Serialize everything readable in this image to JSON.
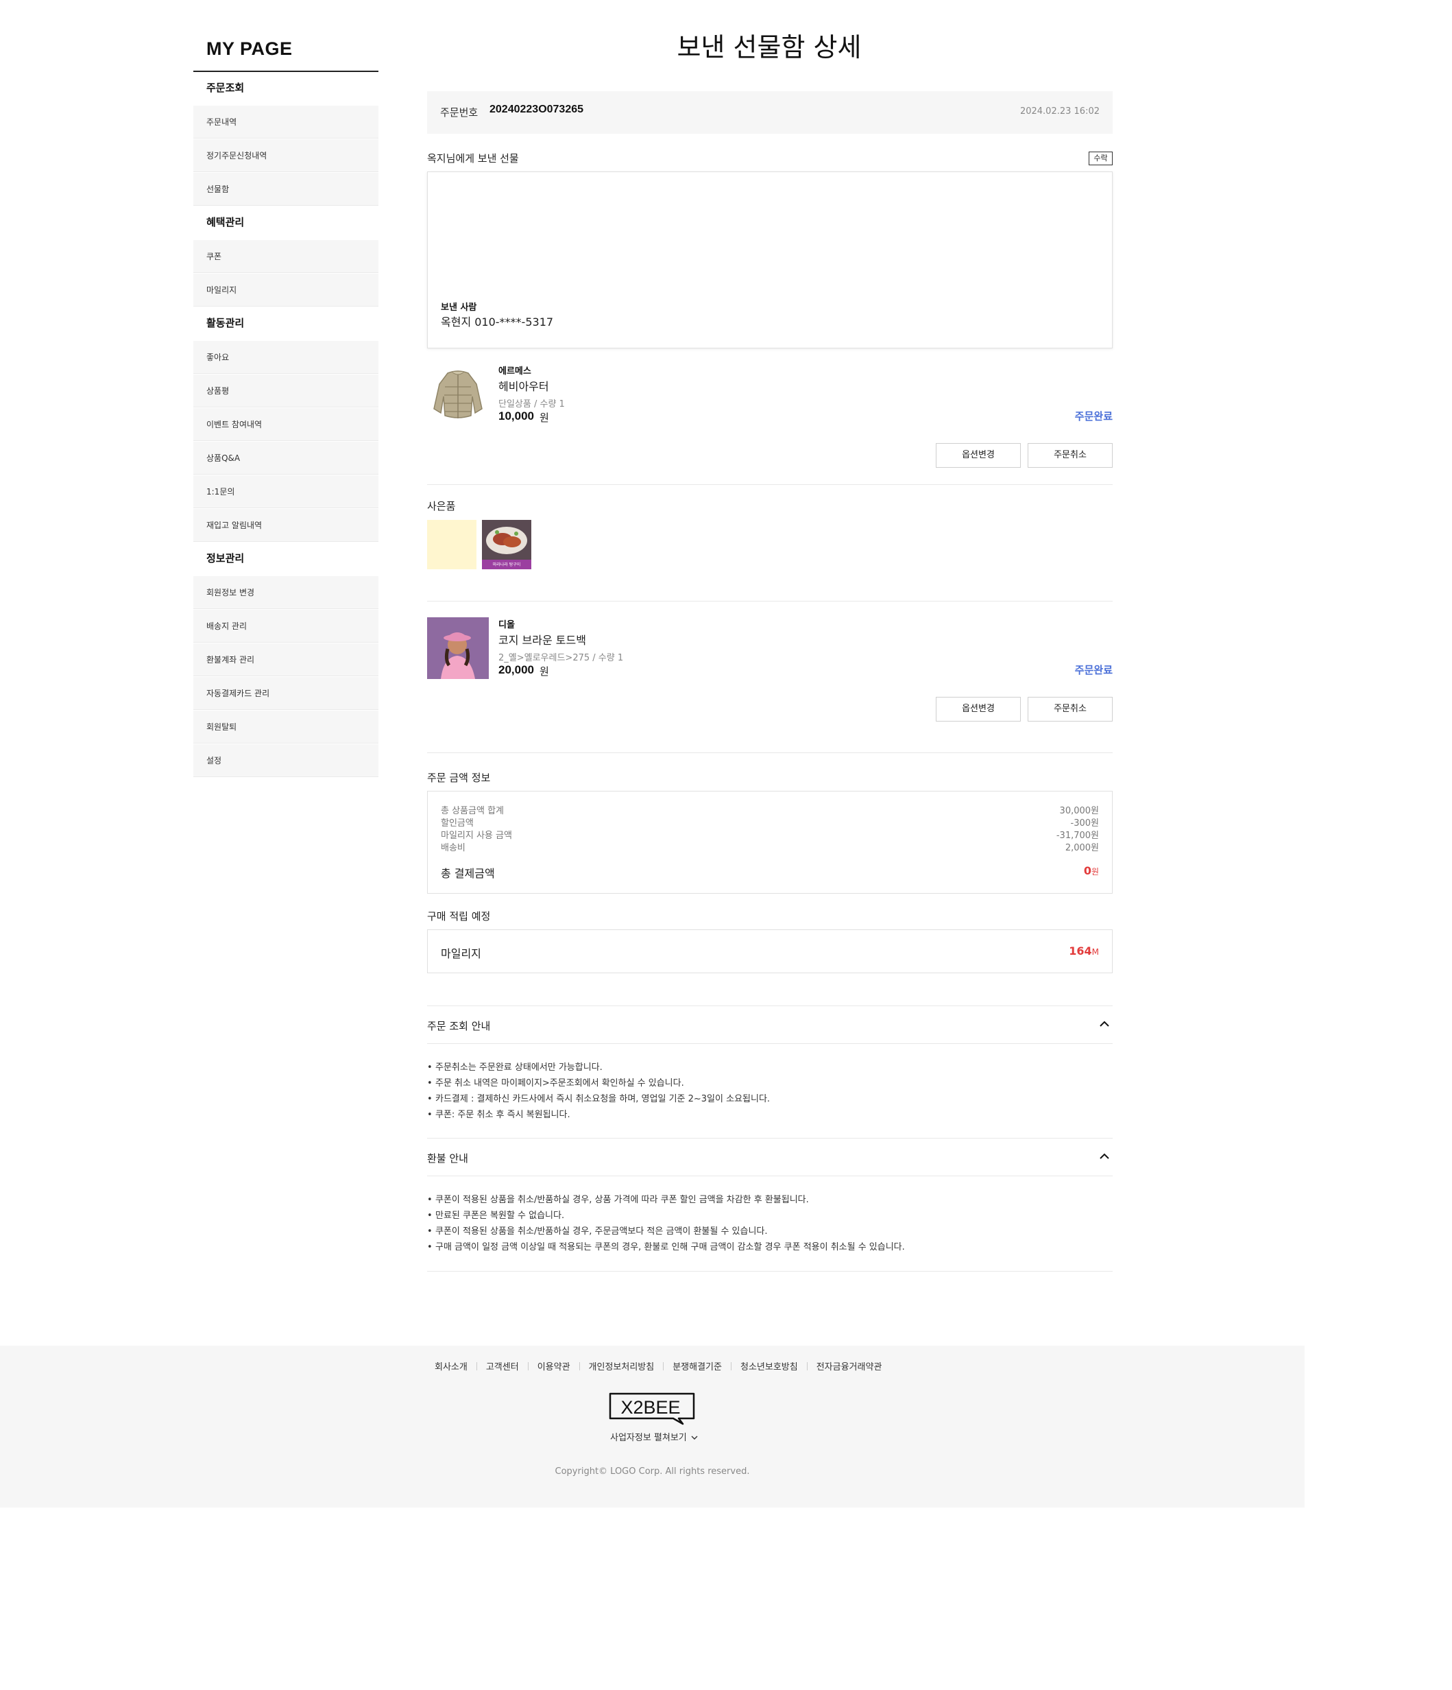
{
  "sidebar": {
    "title": "MY PAGE",
    "sections": [
      {
        "label": "주문조회",
        "items": [
          "주문내역",
          "정기주문신청내역",
          "선물함"
        ]
      },
      {
        "label": "혜택관리",
        "items": [
          "쿠폰",
          "마일리지"
        ]
      },
      {
        "label": "활동관리",
        "items": [
          "좋아요",
          "상품평",
          "이벤트 참여내역",
          "상품Q&A",
          "1:1문의",
          "재입고 알림내역"
        ]
      },
      {
        "label": "정보관리",
        "items": [
          "회원정보 변경",
          "배송지 관리",
          "환불계좌 관리",
          "자동결제카드 관리",
          "회원탈퇴",
          "설정"
        ]
      }
    ]
  },
  "page": {
    "title": "보낸 선물함 상세"
  },
  "order": {
    "label": "주문번호",
    "number": "20240223O073265",
    "date": "2024.02.23 16:02"
  },
  "gift": {
    "title": "옥지님에게 보낸 선물",
    "badge": "수락",
    "sender_label": "보낸 사람",
    "sender_value": "옥현지 010-****-5317"
  },
  "products": [
    {
      "brand": "에르메스",
      "name": "헤비아우터",
      "option": "단일상품 / 수량 1",
      "price": "10,000",
      "unit": "원",
      "status": "주문완료",
      "btn_option": "옵션변경",
      "btn_cancel": "주문취소",
      "thumb": "puffer-jacket-image"
    },
    {
      "brand": "디올",
      "name": "코지 브라운 토드백",
      "option": "2_옐>옐로우레드>275 / 수량 1",
      "price": "20,000",
      "unit": "원",
      "status": "주문완료",
      "btn_option": "옵션변경",
      "btn_cancel": "주문취소",
      "thumb": "woman-pink-hat-image"
    }
  ],
  "freebie": {
    "title": "사은품",
    "item2_caption": "마라나라 탕구이"
  },
  "amount": {
    "title": "주문 금액 정보",
    "rows": [
      {
        "label": "총 상품금액 합계",
        "value": "30,000원"
      },
      {
        "label": "할인금액",
        "value": "-300원"
      },
      {
        "label": "마일리지 사용 금액",
        "value": "-31,700원"
      },
      {
        "label": "배송비",
        "value": "2,000원"
      }
    ],
    "total_label": "총 결제금액",
    "total_value": "0",
    "total_unit": "원"
  },
  "points": {
    "title": "구매 적립 예정",
    "label": "마일리지",
    "value": "164",
    "unit": "M"
  },
  "order_guide": {
    "title": "주문 조회 안내",
    "items": [
      "주문취소는 주문완료 상태에서만 가능합니다.",
      "주문 취소 내역은 마이페이지>주문조회에서 확인하실 수 있습니다.",
      "카드결제 : 결제하신 카드사에서 즉시 취소요청을 하며, 영업일 기준 2~3일이 소요됩니다.",
      "쿠폰: 주문 취소 후 즉시 복원됩니다."
    ]
  },
  "refund_guide": {
    "title": "환불 안내",
    "items": [
      "쿠폰이 적용된 상품을 취소/반품하실 경우, 상품 가격에 따라 쿠폰 할인 금액을 차감한 후 환불됩니다.",
      "만료된 쿠폰은 복원할 수 없습니다.",
      "쿠폰이 적용된 상품을 취소/반품하실 경우, 주문금액보다 적은 금액이 환불될 수 있습니다.",
      "구매 금액이 일정 금액 이상일 때 적용되는 쿠폰의 경우, 환불로 인해 구매 금액이 감소할 경우 쿠폰 적용이 취소될 수 있습니다."
    ]
  },
  "footer": {
    "links": [
      "회사소개",
      "고객센터",
      "이용약관",
      "개인정보처리방침",
      "분쟁해결기준",
      "청소년보호방침",
      "전자금융거래약관"
    ],
    "logo": "X2BEE",
    "biz_info": "사업자정보 펼쳐보기",
    "copyright": "Copyright© LOGO Corp. All rights reserved."
  },
  "colors": {
    "accent_blue": "#4a6fd8",
    "accent_red": "#e23b3b"
  }
}
